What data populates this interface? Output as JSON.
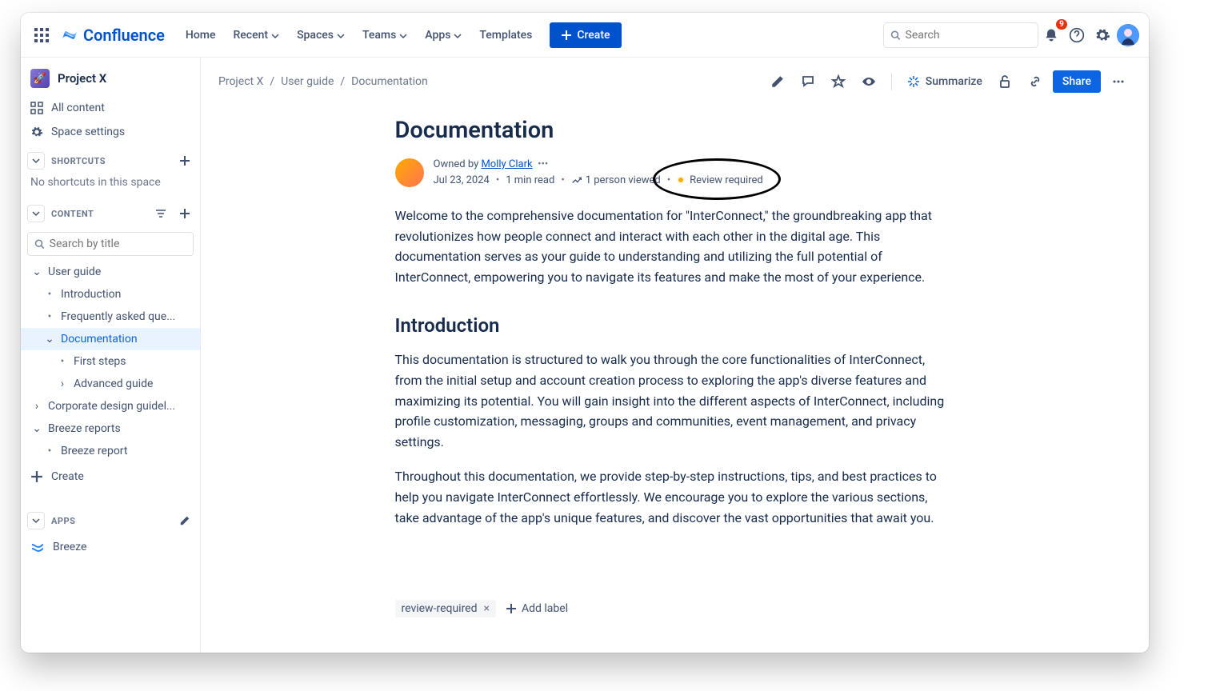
{
  "topnav": {
    "brand": "Confluence",
    "items": [
      "Home",
      "Recent",
      "Spaces",
      "Teams",
      "Apps",
      "Templates"
    ],
    "create": "Create",
    "search_ph": "Search",
    "notif_count": "9"
  },
  "sidebar": {
    "space": "Project X",
    "all_content": "All content",
    "space_settings": "Space settings",
    "shortcuts_label": "SHORTCUTS",
    "no_shortcuts": "No shortcuts in this space",
    "content_label": "CONTENT",
    "search_ph": "Search by title",
    "tree": {
      "user_guide": "User guide",
      "intro": "Introduction",
      "faq": "Frequently asked que...",
      "doc": "Documentation",
      "first": "First steps",
      "adv": "Advanced guide",
      "cdg": "Corporate design guidel...",
      "breports": "Breeze reports",
      "breport": "Breeze report"
    },
    "create": "Create",
    "apps_label": "APPS",
    "breeze": "Breeze"
  },
  "page": {
    "crumbs": [
      "Project X",
      "User guide",
      "Documentation"
    ],
    "summarize": "Summarize",
    "share": "Share",
    "title": "Documentation",
    "owned_by_prefix": "Owned by ",
    "author": "Molly Clark",
    "date": "Jul 23, 2024",
    "read": "1 min read",
    "views": "1 person viewed",
    "status": "Review required",
    "p1": "Welcome to the comprehensive documentation for \"InterConnect,\" the groundbreaking app that revolutionizes how people connect and interact with each other in the digital age. This documentation serves as your guide to understanding and utilizing the full potential of InterConnect, empowering you to navigate its features and make the most of your experience.",
    "h2": "Introduction",
    "p2": "This documentation is structured to walk you through the core functionalities of InterConnect, from the initial setup and account creation process to exploring the app's diverse features and maximizing its potential. You will gain insight into the different aspects of InterConnect, including profile customization, messaging, groups and communities, event management, and privacy settings.",
    "p3": "Throughout this documentation, we provide step-by-step instructions, tips, and best practices to help you navigate InterConnect effortlessly. We encourage you to explore the various sections, take advantage of the app's unique features, and discover the vast opportunities that await you.",
    "tag": "review-required",
    "add_label": "Add label"
  }
}
